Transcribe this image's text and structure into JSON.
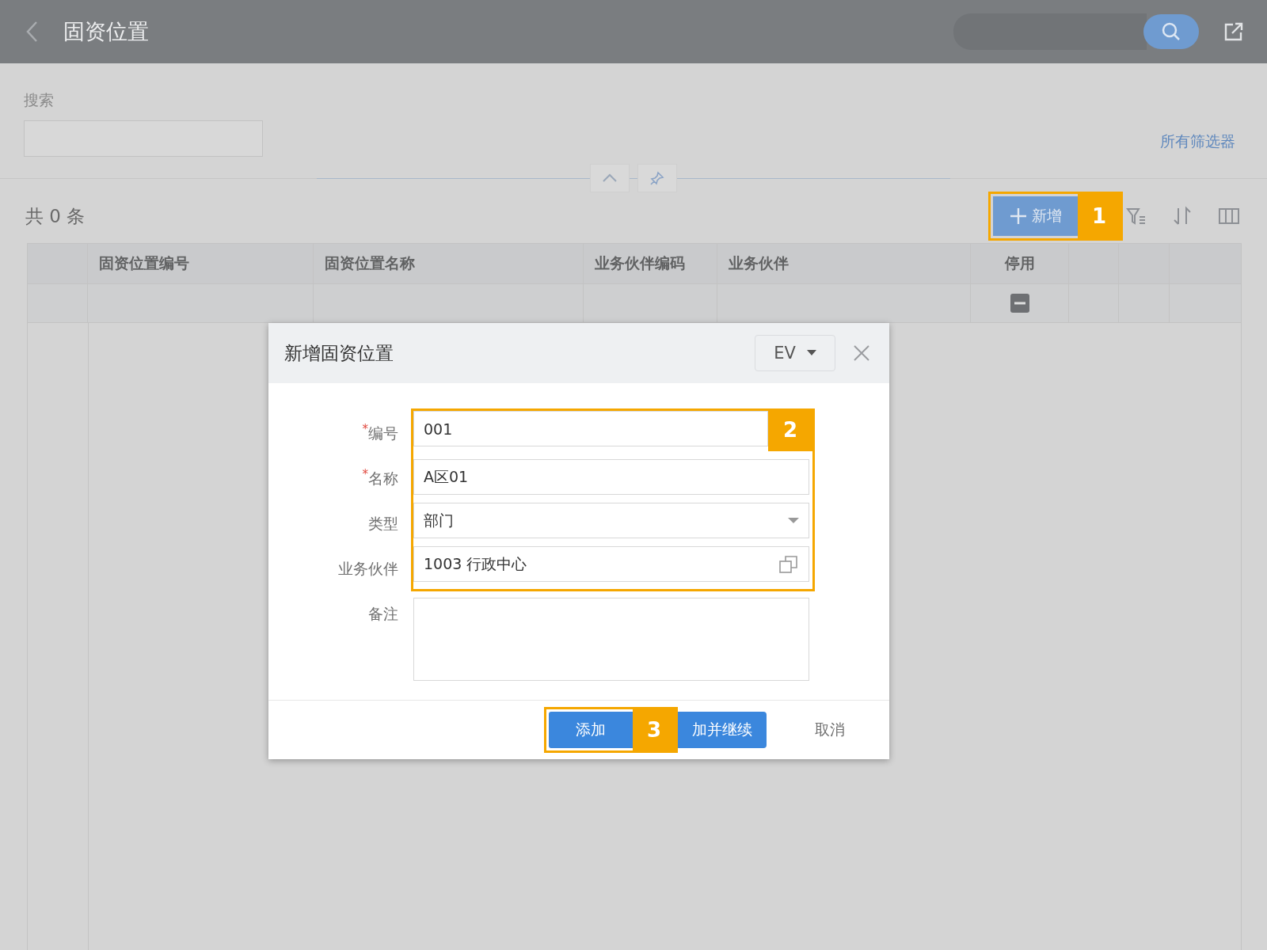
{
  "header": {
    "title": "固资位置"
  },
  "filter": {
    "search_label": "搜索",
    "all_filters_link": "所有筛选器"
  },
  "list": {
    "count": "共 0 条",
    "add_button": "新增",
    "add_callout": "1"
  },
  "table": {
    "columns": [
      {
        "label": "固资位置编号",
        "kind": "text"
      },
      {
        "label": "固资位置名称",
        "kind": "text"
      },
      {
        "label": "业务伙伴编码",
        "kind": "text"
      },
      {
        "label": "业务伙伴",
        "kind": "text"
      },
      {
        "label": "停用",
        "kind": "flag"
      }
    ],
    "rows": [
      {
        "stopped": false
      }
    ]
  },
  "dialog": {
    "title": "新增固资位置",
    "language": "EV",
    "fields_callout": "2",
    "fields": [
      {
        "label": "编号",
        "required_mark": "*",
        "kind": "text",
        "value": "001"
      },
      {
        "label": "名称",
        "required_mark": "*",
        "kind": "text",
        "value": "A区01"
      },
      {
        "label": "类型",
        "kind": "select",
        "value": "部门"
      },
      {
        "label": "业务伙伴",
        "kind": "lookup",
        "value": "1003 行政中心"
      },
      {
        "label": "备注",
        "kind": "textarea"
      }
    ],
    "add_callout": "3",
    "buttons": [
      {
        "label": "添加",
        "kind": "primary"
      },
      {
        "label": "加并继续",
        "kind": "primary"
      },
      {
        "label": "取消",
        "kind": "text"
      }
    ]
  }
}
